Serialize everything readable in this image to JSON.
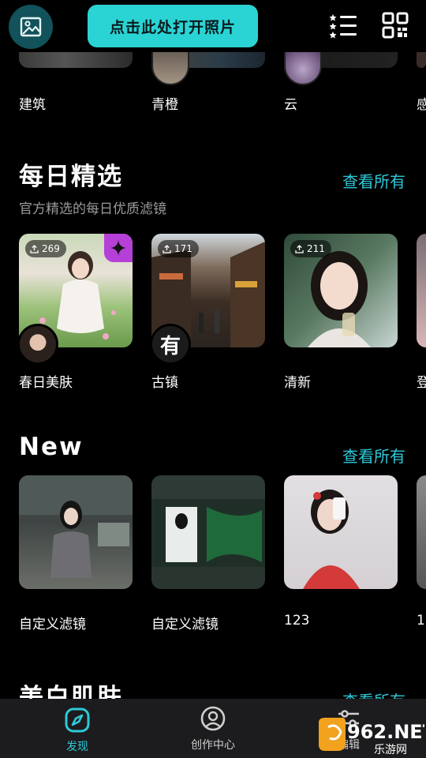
{
  "header": {
    "open_photo_label": "点击此处打开照片",
    "icons": [
      "gallery-icon",
      "star-list-icon",
      "qr-code-icon"
    ]
  },
  "categories": [
    {
      "label": "建筑"
    },
    {
      "label": "青橙"
    },
    {
      "label": "云"
    },
    {
      "label": "感"
    }
  ],
  "daily": {
    "title": "每日精选",
    "subtitle": "官方精选的每日优质滤镜",
    "see_all": "查看所有",
    "items": [
      {
        "label": "春日美肤",
        "count": "269"
      },
      {
        "label": "古镇",
        "count": "171",
        "avatar_char": "有"
      },
      {
        "label": "清新",
        "count": "211"
      },
      {
        "label": "登"
      }
    ]
  },
  "new": {
    "title": "New",
    "see_all": "查看所有",
    "items": [
      {
        "label": "自定义滤镜"
      },
      {
        "label": "自定义滤镜"
      },
      {
        "label": "123"
      },
      {
        "label": "1"
      }
    ]
  },
  "next_section": {
    "title": "美白肌肤",
    "see_all": "查看所有"
  },
  "nav": {
    "discover": "发现",
    "create": "创作中心",
    "edit": "编辑"
  },
  "watermark": {
    "brand": "962.NET",
    "sub": "乐游网"
  },
  "colors": {
    "accent": "#2bd4d4",
    "link": "#2ec9d8",
    "sparkle": "#b63fd8",
    "nav_bg": "#1c1c1e"
  }
}
